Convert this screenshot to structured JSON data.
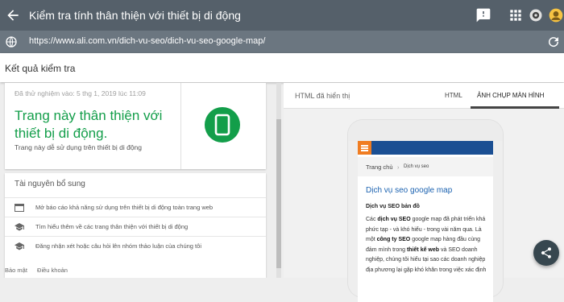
{
  "topbar": {
    "title": "Kiểm tra tính thân thiện với thiết bị di động",
    "icons": [
      "back-arrow-icon",
      "feedback-icon",
      "apps-grid-icon",
      "extension-icon",
      "account-avatar-icon"
    ]
  },
  "urlbar": {
    "url": "https://www.ali.com.vn/dich-vu-seo/dich-vu-seo-google-map/"
  },
  "result": {
    "heading": "Kết quả kiểm tra"
  },
  "summary": {
    "tested": "Đã thử nghiệm vào: 5 thg 1, 2019 lúc 11:09",
    "verdict": "Trang này thân thiện với thiết bị di động.",
    "subtitle": "Trang này dễ sử dụng trên thiết bị di động",
    "accent": "#139e4a"
  },
  "resources": {
    "heading": "Tài nguyên bổ sung",
    "items": [
      {
        "icon": "web-icon",
        "label": "Mở báo cáo khả năng sử dụng trên thiết bị di động toàn trang web"
      },
      {
        "icon": "school-icon",
        "label": "Tìm hiểu thêm về các trang thân thiện với thiết bị di động"
      },
      {
        "icon": "school-icon",
        "label": "Đăng nhận xét hoặc câu hỏi lên nhóm thảo luận của chúng tôi"
      }
    ]
  },
  "footer": {
    "privacy": "Bảo mật",
    "terms": "Điều khoản"
  },
  "preview": {
    "rendered_label": "HTML đã hiển thị",
    "tab_html": "HTML",
    "tab_screenshot": "ẢNH CHỤP MÀN HÌNH",
    "active_tab": "tab_screenshot"
  },
  "phone_page": {
    "crumb_home": "Trang chủ",
    "crumb_sep": "›",
    "crumb_current": "Dịch vụ seo",
    "title": "Dịch vụ seo google map",
    "h2": "Dịch vụ SEO bản đồ",
    "para": [
      {
        "t": "Các "
      },
      {
        "b": "dịch vụ SEO"
      },
      {
        "t": " google map đã phát triển khá phức tạp - và khó hiểu - trong vài năm qua. Là một "
      },
      {
        "b": "công ty SEO"
      },
      {
        "t": " google map hàng đầu cùng đảm mình trong "
      },
      {
        "b": "thiết kế web"
      },
      {
        "t": " và SEO doanh nghiệp, chúng tôi hiểu tại sao các doanh nghiệp địa phương lại gặp khó khăn trong việc xác định"
      }
    ],
    "nav_color": "#1b4f93",
    "menu_color": "#f07d22"
  }
}
